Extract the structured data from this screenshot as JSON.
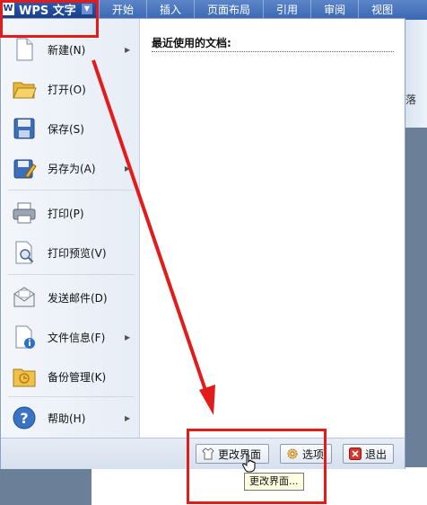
{
  "app": {
    "logo_glyph": "W",
    "title": "WPS 文字"
  },
  "ribbon": {
    "tabs": [
      "开始",
      "插入",
      "页面布局",
      "引用",
      "审阅",
      "视图"
    ],
    "partial_text": "落"
  },
  "menu": {
    "items": [
      {
        "label": "新建(N)",
        "icon": "new-document-icon",
        "has_submenu": true
      },
      {
        "label": "打开(O)",
        "icon": "open-folder-icon",
        "has_submenu": false
      },
      {
        "label": "保存(S)",
        "icon": "save-disk-icon",
        "has_submenu": false
      },
      {
        "label": "另存为(A)",
        "icon": "save-as-icon",
        "has_submenu": true
      },
      {
        "label": "打印(P)",
        "icon": "printer-icon",
        "has_submenu": false
      },
      {
        "label": "打印预览(V)",
        "icon": "print-preview-icon",
        "has_submenu": false
      },
      {
        "label": "发送邮件(D)",
        "icon": "mail-icon",
        "has_submenu": false
      },
      {
        "label": "文件信息(F)",
        "icon": "file-info-icon",
        "has_submenu": true
      },
      {
        "label": "备份管理(K)",
        "icon": "backup-folder-icon",
        "has_submenu": false
      },
      {
        "label": "帮助(H)",
        "icon": "help-icon",
        "has_submenu": true
      }
    ],
    "recent_title": "最近使用的文档:"
  },
  "footer": {
    "change_ui_label": "更改界面",
    "options_label": "选项",
    "exit_label": "退出"
  },
  "tooltip": {
    "text": "更改界面..."
  },
  "colors": {
    "annotation": "#e31b1b",
    "ribbon": "#3a66b4"
  }
}
